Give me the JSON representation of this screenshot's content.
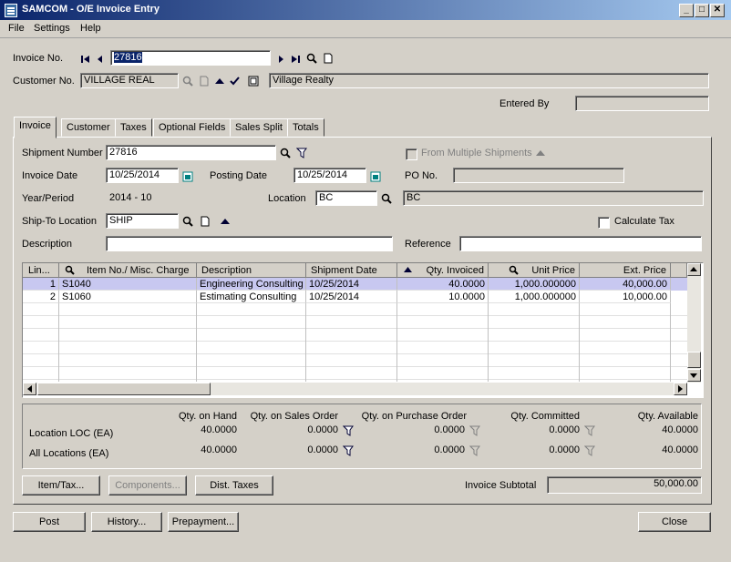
{
  "window": {
    "title": "SAMCOM - O/E Invoice Entry"
  },
  "menu": [
    {
      "label": "File"
    },
    {
      "label": "Settings"
    },
    {
      "label": "Help"
    }
  ],
  "header": {
    "invoice_no_label": "Invoice No.",
    "invoice_no_value": "27816",
    "customer_no_label": "Customer No.",
    "customer_no_value": "VILLAGE REAL",
    "customer_name": "Village Realty",
    "entered_by_label": "Entered By",
    "entered_by_value": ""
  },
  "tabs": [
    {
      "label": "Invoice"
    },
    {
      "label": "Customer"
    },
    {
      "label": "Taxes"
    },
    {
      "label": "Optional Fields"
    },
    {
      "label": "Sales Split"
    },
    {
      "label": "Totals"
    }
  ],
  "form": {
    "shipment_number_label": "Shipment Number",
    "shipment_number_value": "27816",
    "from_multiple_shipments_label": "From Multiple Shipments",
    "invoice_date_label": "Invoice Date",
    "invoice_date_value": "10/25/2014",
    "posting_date_label": "Posting Date",
    "posting_date_value": "10/25/2014",
    "po_no_label": "PO No.",
    "po_no_value": "",
    "year_period_label": "Year/Period",
    "year_period_value": "2014 - 10",
    "location_label": "Location",
    "location_value": "BC",
    "location_desc": "BC",
    "ship_to_label": "Ship-To Location",
    "ship_to_value": "SHIP",
    "calculate_tax_label": "Calculate Tax",
    "description_label": "Description",
    "description_value": "",
    "reference_label": "Reference",
    "reference_value": ""
  },
  "grid": {
    "columns": [
      "Lin...",
      "Item No./ Misc. Charge",
      "Description",
      "Shipment Date",
      "Qty. Invoiced",
      "Unit Price",
      "Ext. Price"
    ],
    "rows": [
      {
        "line": "1",
        "item": "S1040",
        "description": "Engineering Consulting",
        "ship_date": "10/25/2014",
        "qty": "40.0000",
        "unit_price": "1,000.000000",
        "ext_price": "40,000.00"
      },
      {
        "line": "2",
        "item": "S1060",
        "description": "Estimating Consulting",
        "ship_date": "10/25/2014",
        "qty": "10.0000",
        "unit_price": "1,000.000000",
        "ext_price": "10,000.00"
      }
    ]
  },
  "quantities": {
    "headers": [
      "Qty. on Hand",
      "Qty. on Sales Order",
      "Qty. on Purchase Order",
      "Qty. Committed",
      "Qty. Available"
    ],
    "location_label": "Location  LOC (EA)",
    "location_values": [
      "40.0000",
      "0.0000",
      "0.0000",
      "0.0000",
      "40.0000"
    ],
    "all_label": "All Locations (EA)",
    "all_values": [
      "40.0000",
      "0.0000",
      "0.0000",
      "0.0000",
      "40.0000"
    ]
  },
  "buttons": {
    "item_tax": "Item/Tax...",
    "components": "Components...",
    "dist_taxes": "Dist. Taxes",
    "post": "Post",
    "history": "History...",
    "prepayment": "Prepayment...",
    "close": "Close"
  },
  "subtotal": {
    "label": "Invoice Subtotal",
    "value": "50,000.00"
  },
  "colors": {
    "title_start": "#0a246a",
    "title_end": "#a6caf0",
    "selected_row": "#c8c8f0"
  }
}
